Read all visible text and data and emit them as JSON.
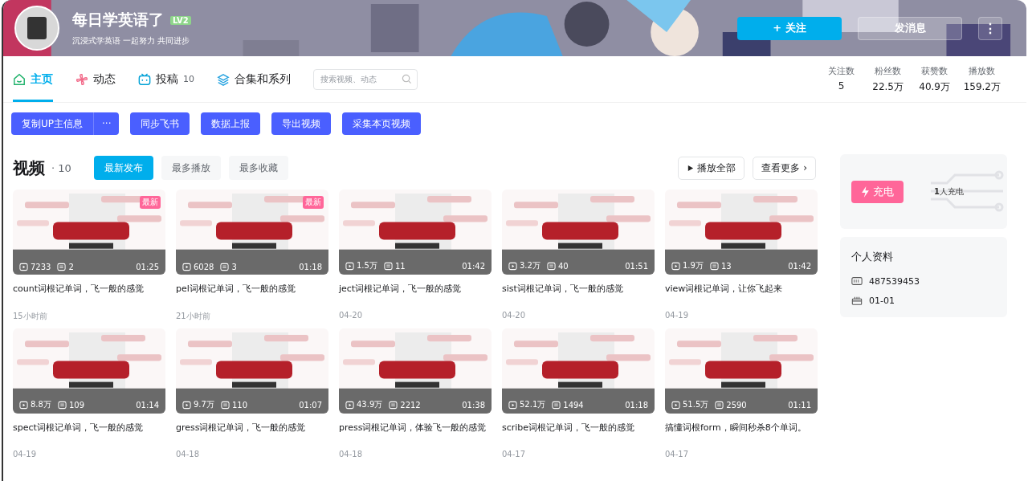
{
  "header": {
    "name": "每日学英语了",
    "level": "LV2",
    "motto": "沉浸式学英语 一起努力 共同进步",
    "follow": "+ 关注",
    "message": "发消息",
    "more": "⋮"
  },
  "tabs": [
    {
      "label": "主页",
      "selected": true
    },
    {
      "label": "动态",
      "selected": false
    },
    {
      "label": "投稿",
      "count": "10",
      "selected": false
    },
    {
      "label": "合集和系列",
      "selected": false
    }
  ],
  "search": {
    "placeholder": "搜索视频、动态"
  },
  "stats": [
    {
      "label": "关注数",
      "value": "5"
    },
    {
      "label": "粉丝数",
      "value": "22.5万"
    },
    {
      "label": "获赞数",
      "value": "40.9万"
    },
    {
      "label": "播放数",
      "value": "159.2万"
    }
  ],
  "tools": {
    "main": "复制UP主信息",
    "menu": "···",
    "buttons": [
      "同步飞书",
      "数据上报",
      "导出视频",
      "采集本页视频"
    ]
  },
  "videos_section": {
    "title": "视频",
    "count": "· 10",
    "sorts": [
      {
        "label": "最新发布",
        "selected": true
      },
      {
        "label": "最多播放",
        "selected": false
      },
      {
        "label": "最多收藏",
        "selected": false
      }
    ],
    "play_all": "播放全部",
    "see_more": "查看更多 ›"
  },
  "videos": [
    {
      "badge": "最新",
      "plays": "7233",
      "comments": "2",
      "duration": "01:25",
      "title": "count词根记单词，飞一般的感觉",
      "date": "15小时前"
    },
    {
      "badge": "最新",
      "plays": "6028",
      "comments": "3",
      "duration": "01:18",
      "title": "pel词根记单词，飞一般的感觉",
      "date": "21小时前"
    },
    {
      "plays": "1.5万",
      "comments": "11",
      "duration": "01:42",
      "title": "ject词根记单词，飞一般的感觉",
      "date": "04-20"
    },
    {
      "plays": "3.2万",
      "comments": "40",
      "duration": "01:51",
      "title": "sist词根记单词，飞一般的感觉",
      "date": "04-20"
    },
    {
      "plays": "1.9万",
      "comments": "13",
      "duration": "01:42",
      "title": "view词根记单词，让你飞起来",
      "date": "04-19"
    },
    {
      "plays": "8.8万",
      "comments": "109",
      "duration": "01:14",
      "title": "spect词根记单词，飞一般的感觉",
      "date": "04-19"
    },
    {
      "plays": "9.7万",
      "comments": "110",
      "duration": "01:07",
      "title": "gress词根记单词，飞一般的感觉",
      "date": "04-18"
    },
    {
      "plays": "43.9万",
      "comments": "2212",
      "duration": "01:38",
      "title": "press词根记单词，体验飞一般的感觉",
      "date": "04-18"
    },
    {
      "plays": "52.1万",
      "comments": "1494",
      "duration": "01:18",
      "title": "scribe词根记单词，飞一般的感觉",
      "date": "04-17"
    },
    {
      "plays": "51.5万",
      "comments": "2590",
      "duration": "01:11",
      "title": "搞懂词根form，瞬间秒杀8个单词。",
      "date": "04-17"
    }
  ],
  "charge": {
    "button": "充电",
    "count": "1",
    "text": "人充电"
  },
  "profile": {
    "title": "个人资料",
    "items": [
      {
        "text": "487539453"
      },
      {
        "text": "01-01"
      }
    ]
  }
}
